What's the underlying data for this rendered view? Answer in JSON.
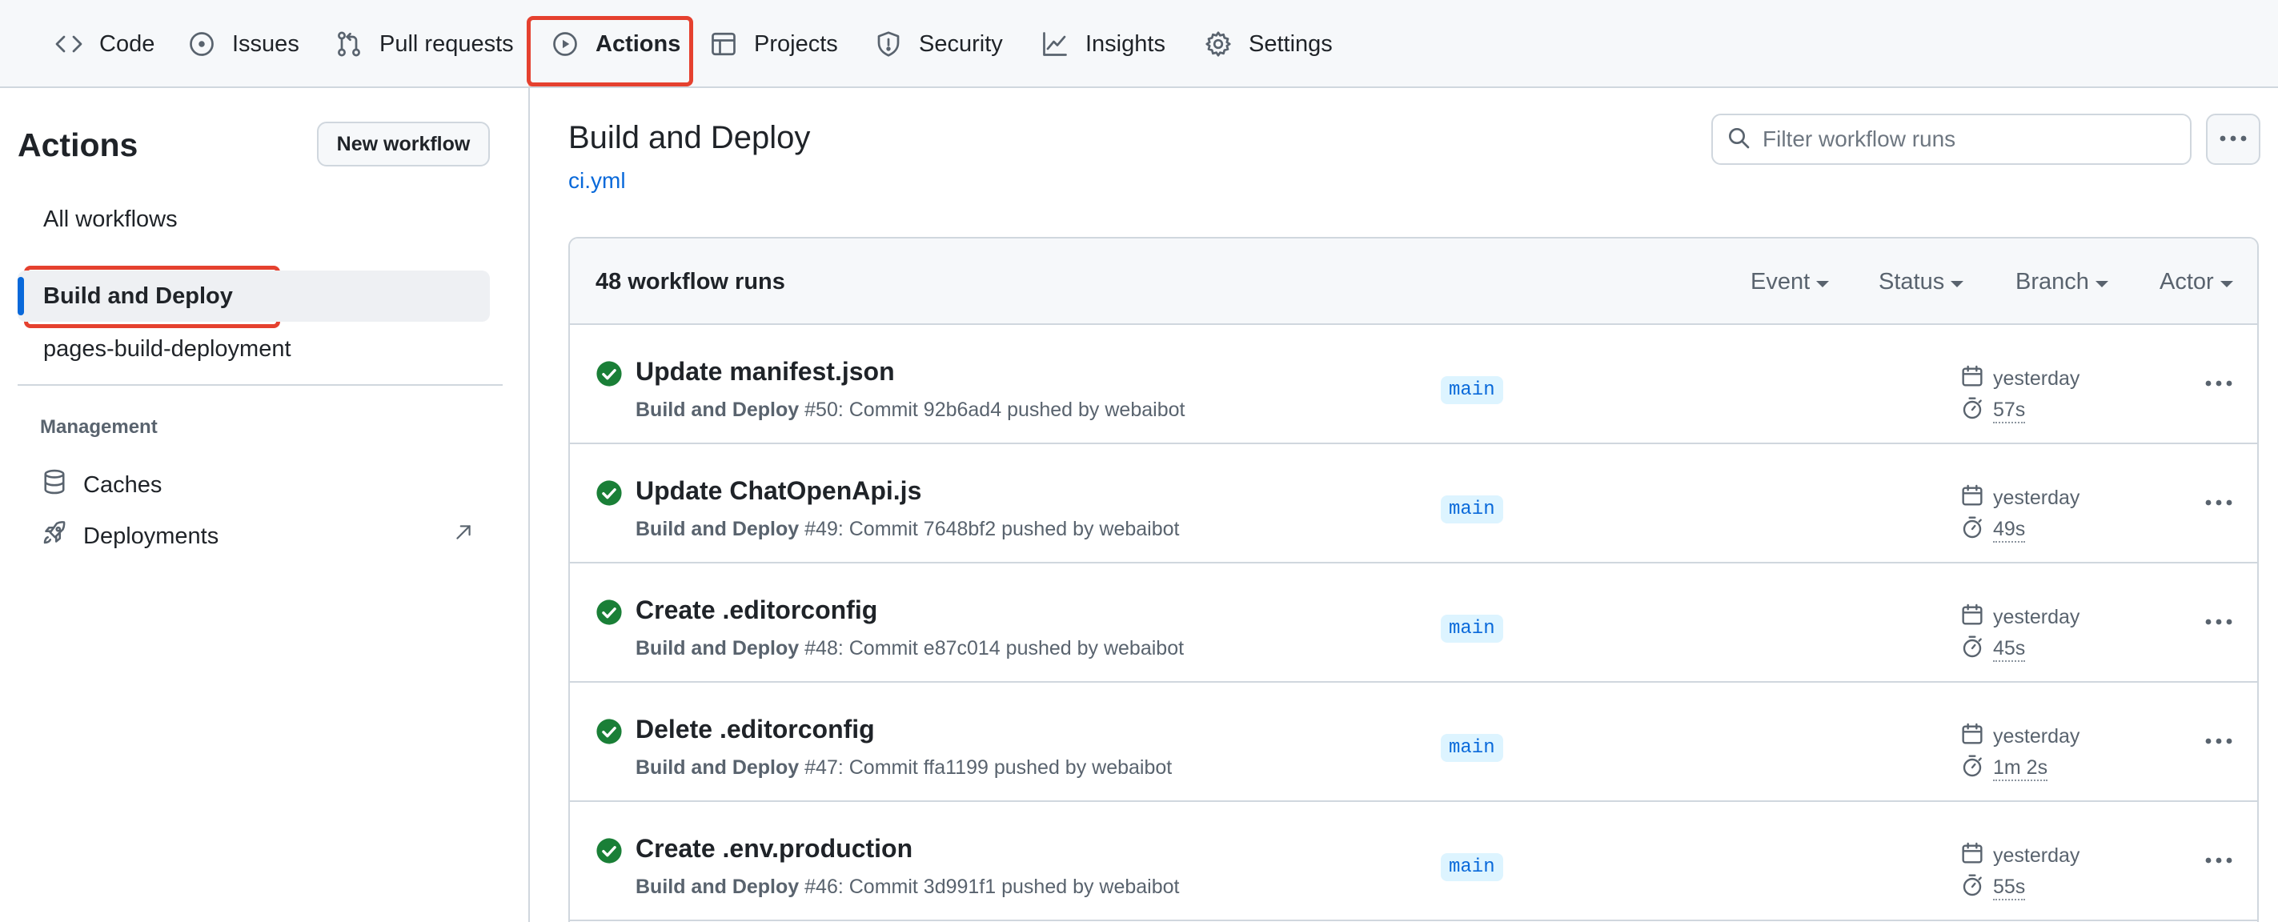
{
  "nav": {
    "tabs": [
      {
        "label": "Code",
        "icon": "code-icon"
      },
      {
        "label": "Issues",
        "icon": "issue-icon"
      },
      {
        "label": "Pull requests",
        "icon": "pull-request-icon"
      },
      {
        "label": "Actions",
        "icon": "play-icon",
        "active": true
      },
      {
        "label": "Projects",
        "icon": "table-icon"
      },
      {
        "label": "Security",
        "icon": "shield-icon"
      },
      {
        "label": "Insights",
        "icon": "graph-icon"
      },
      {
        "label": "Settings",
        "icon": "gear-icon"
      }
    ]
  },
  "sidebar": {
    "title": "Actions",
    "new_workflow_label": "New workflow",
    "workflows": [
      {
        "label": "All workflows"
      },
      {
        "label": "Build and Deploy",
        "active": true
      },
      {
        "label": "pages-build-deployment"
      }
    ],
    "management_heading": "Management",
    "management": [
      {
        "label": "Caches",
        "icon": "database-icon"
      },
      {
        "label": "Deployments",
        "icon": "rocket-icon",
        "external": true
      }
    ]
  },
  "main": {
    "workflow_title": "Build and Deploy",
    "workflow_file": "ci.yml",
    "filter_placeholder": "Filter workflow runs",
    "runs_count": "48 workflow runs",
    "filters": [
      "Event",
      "Status",
      "Branch",
      "Actor"
    ],
    "runs": [
      {
        "title": "Update manifest.json",
        "workflow": "Build and Deploy",
        "detail": " #50: Commit 92b6ad4 pushed by webaibot",
        "branch": "main",
        "date": "yesterday",
        "duration": "57s",
        "status": "success"
      },
      {
        "title": "Update ChatOpenApi.js",
        "workflow": "Build and Deploy",
        "detail": " #49: Commit 7648bf2 pushed by webaibot",
        "branch": "main",
        "date": "yesterday",
        "duration": "49s",
        "status": "success"
      },
      {
        "title": "Create .editorconfig",
        "workflow": "Build and Deploy",
        "detail": " #48: Commit e87c014 pushed by webaibot",
        "branch": "main",
        "date": "yesterday",
        "duration": "45s",
        "status": "success"
      },
      {
        "title": "Delete .editorconfig",
        "workflow": "Build and Deploy",
        "detail": " #47: Commit ffa1199 pushed by webaibot",
        "branch": "main",
        "date": "yesterday",
        "duration": "1m 2s",
        "status": "success"
      },
      {
        "title": "Create .env.production",
        "workflow": "Build and Deploy",
        "detail": " #46: Commit 3d991f1 pushed by webaibot",
        "branch": "main",
        "date": "yesterday",
        "duration": "55s",
        "status": "success"
      }
    ]
  },
  "colors": {
    "accent": "#0969da",
    "success": "#1a7f37",
    "highlight": "#e5412f",
    "tab_underline": "#fd8c73"
  }
}
